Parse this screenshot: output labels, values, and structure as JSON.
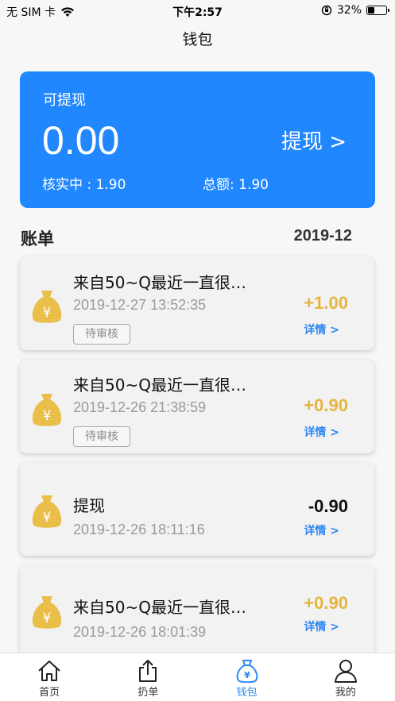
{
  "status_bar": {
    "carrier": "无 SIM 卡",
    "time": "下午2:57",
    "battery": "32%",
    "battery_level": 0.32
  },
  "nav": {
    "title": "钱包"
  },
  "balance": {
    "label": "可提现",
    "amount": "0.00",
    "withdraw_label": "提现 >",
    "pending": "核实中 : 1.90",
    "total": "总额: 1.90"
  },
  "bills": {
    "title": "账单",
    "month": "2019-12",
    "items": [
      {
        "title": "来自50~Q最近一直很…",
        "time": "2019-12-27 13:52:35",
        "tag": "待审核",
        "amount": "+1.00",
        "detail": "详情 >"
      },
      {
        "title": "来自50~Q最近一直很…",
        "time": "2019-12-26 21:38:59",
        "tag": "待审核",
        "amount": "+0.90",
        "detail": "详情 >"
      },
      {
        "title": "提现",
        "time": "2019-12-26 18:11:16",
        "amount": "-0.90",
        "detail": "详情 >"
      },
      {
        "title": "来自50~Q最近一直很…",
        "time": "2019-12-26 18:01:39",
        "amount": "+0.90",
        "detail": "详情 >"
      }
    ]
  },
  "tabs": [
    {
      "label": "首页",
      "icon": "home-icon"
    },
    {
      "label": "扔单",
      "icon": "share-icon"
    },
    {
      "label": "钱包",
      "icon": "wallet-icon",
      "active": true
    },
    {
      "label": "我的",
      "icon": "profile-icon"
    }
  ],
  "colors": {
    "primary": "#2087ff",
    "income": "#e6b53c",
    "link": "#2c88f2"
  }
}
